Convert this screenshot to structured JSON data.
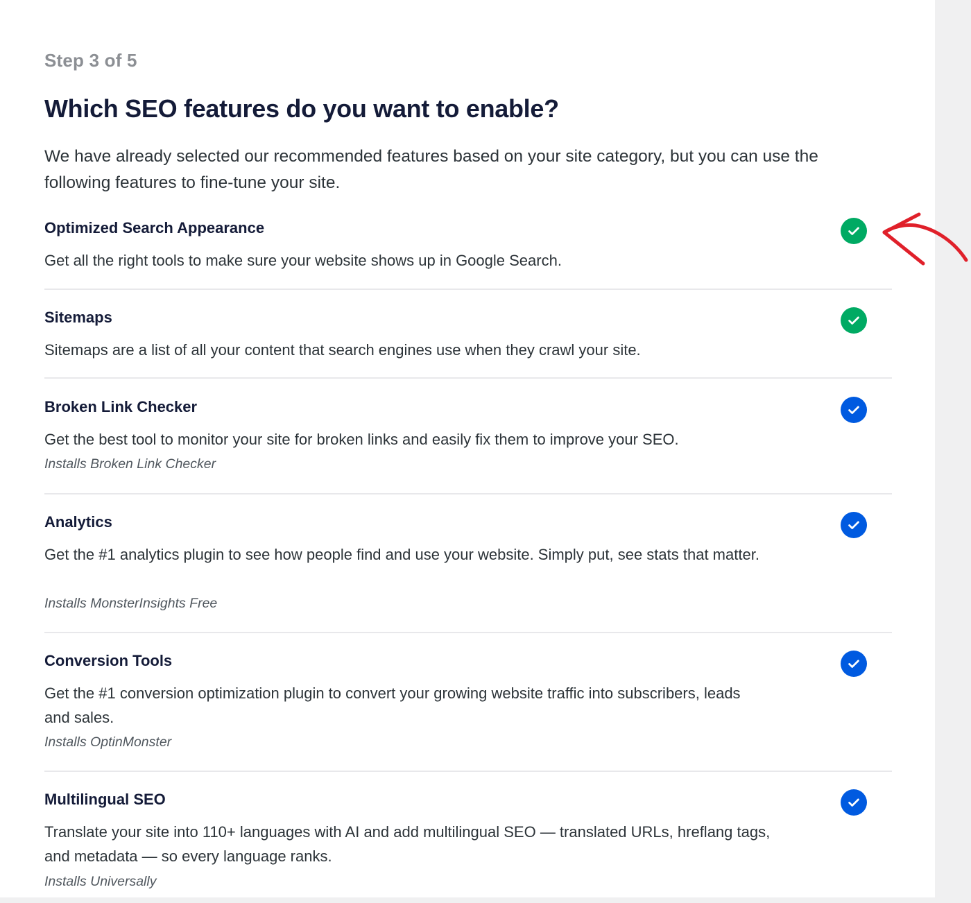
{
  "wizard": {
    "step_label": "Step 3 of 5",
    "title": "Which SEO features do you want to enable?",
    "intro": "We have already selected our recommended features based on your site category, but you can use the following features to fine-tune your site."
  },
  "features": [
    {
      "name": "Optimized Search Appearance",
      "description": "Get all the right tools to make sure your website shows up in Google Search.",
      "installs": "",
      "checked": true,
      "check_color": "green"
    },
    {
      "name": "Sitemaps",
      "description": "Sitemaps are a list of all your content that search engines use when they crawl your site.",
      "installs": "",
      "checked": true,
      "check_color": "green"
    },
    {
      "name": "Broken Link Checker",
      "description": "Get the best tool to monitor your site for broken links and easily fix them to improve your SEO.",
      "installs": "Installs Broken Link Checker",
      "checked": true,
      "check_color": "blue"
    },
    {
      "name": "Analytics",
      "description": "Get the #1 analytics plugin to see how people find and use your website. Simply put, see stats that matter.",
      "installs": "Installs MonsterInsights Free",
      "checked": true,
      "check_color": "blue"
    },
    {
      "name": "Conversion Tools",
      "description": "Get the #1 conversion optimization plugin to convert your growing website traffic into subscribers, leads and sales.",
      "installs": "Installs OptinMonster",
      "checked": true,
      "check_color": "blue"
    },
    {
      "name": "Multilingual SEO",
      "description": "Translate your site into 110+ languages with AI and add multilingual SEO — translated URLs, hreflang tags, and metadata — so every language ranks.",
      "installs": "Installs Universally",
      "checked": true,
      "check_color": "blue"
    }
  ],
  "colors": {
    "green_check": "#00aa63",
    "blue_check": "#005ae0",
    "annotation_arrow": "#e0202a"
  },
  "icons": {
    "check": "checkmark-icon",
    "annotation": "red-arrow-annotation"
  }
}
